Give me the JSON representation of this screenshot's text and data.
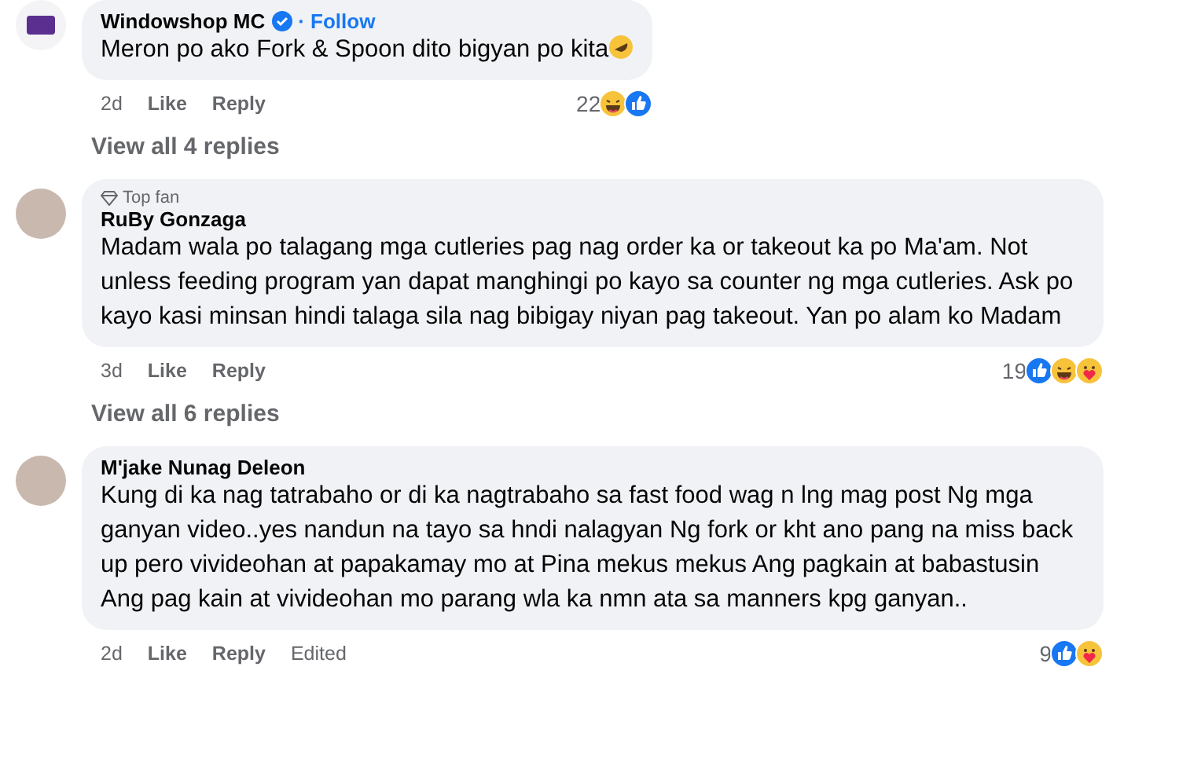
{
  "comments": [
    {
      "author": "Windowshop MC",
      "verified": true,
      "follow": "· Follow",
      "avatar": {
        "kind": "logo"
      },
      "text": "Meron po ako Fork & Spoon dito bigyan po kita",
      "emoji": {
        "kind": "rofl"
      },
      "time": "2d",
      "like": "Like",
      "reply": "Reply",
      "reaction_count": "22",
      "reactions": [
        {
          "kind": "haha"
        },
        {
          "kind": "like"
        }
      ],
      "view_replies": "View all 4 replies"
    },
    {
      "author": "RuBy Gonzaga",
      "top_fan": "Top fan",
      "avatar": {
        "kind": "photo"
      },
      "text": "Madam wala po talagang mga cutleries pag nag order ka or takeout ka po Ma'am. Not unless feeding program yan dapat manghingi po kayo sa counter ng mga cutleries. Ask po kayo kasi minsan hindi talaga sila nag bibigay niyan pag takeout. Yan po alam ko Madam",
      "time": "3d",
      "like": "Like",
      "reply": "Reply",
      "reaction_count": "19",
      "reactions": [
        {
          "kind": "like"
        },
        {
          "kind": "haha"
        },
        {
          "kind": "care"
        }
      ],
      "view_replies": "View all 6 replies"
    },
    {
      "author": "M'jake Nunag Deleon",
      "avatar": {
        "kind": "photo"
      },
      "text": "Kung di ka nag tatrabaho or di ka nagtrabaho sa fast food wag n lng mag post Ng mga ganyan video..yes nandun na tayo sa hndi nalagyan Ng fork or kht ano pang na miss back up pero vivideohan at papakamay mo at Pina mekus mekus Ang pagkain at babastusin Ang pag kain at vivideohan mo parang wla ka nmn ata sa manners kpg ganyan..",
      "time": "2d",
      "like": "Like",
      "reply": "Reply",
      "edited": "Edited",
      "reaction_count": "9",
      "reactions": [
        {
          "kind": "like"
        },
        {
          "kind": "care"
        }
      ]
    }
  ]
}
